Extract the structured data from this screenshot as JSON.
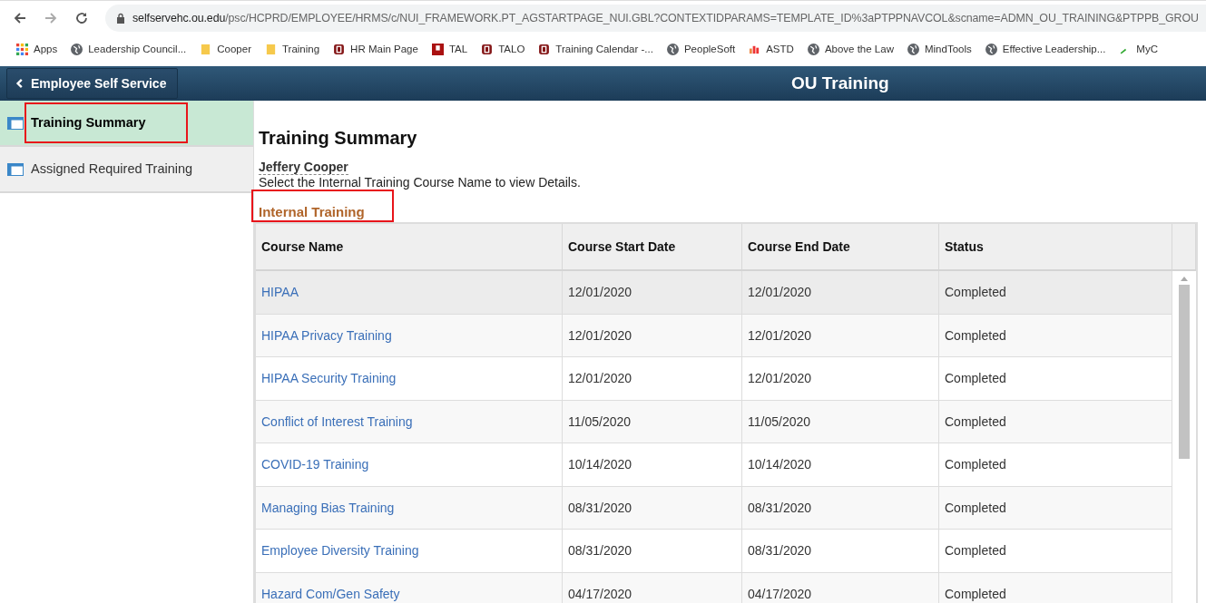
{
  "browser": {
    "url_host": "selfservehc.ou.edu",
    "url_path": "/psc/HCPRD/EMPLOYEE/HRMS/c/NUI_FRAMEWORK.PT_AGSTARTPAGE_NUI.GBL?CONTEXTIDPARAMS=TEMPLATE_ID%3aPTPPNAVCOL&scname=ADMN_OU_TRAINING&PTPPB_GROU",
    "bookmarks": [
      {
        "label": "Apps",
        "kind": "apps"
      },
      {
        "label": "Leadership Council...",
        "kind": "globe"
      },
      {
        "label": "Cooper",
        "kind": "folder"
      },
      {
        "label": "Training",
        "kind": "folder"
      },
      {
        "label": "HR Main Page",
        "kind": "ou"
      },
      {
        "label": "TAL",
        "kind": "hsc"
      },
      {
        "label": "TALO",
        "kind": "ou"
      },
      {
        "label": "Training Calendar -...",
        "kind": "ou"
      },
      {
        "label": "PeopleSoft",
        "kind": "globe"
      },
      {
        "label": "ASTD",
        "kind": "atd"
      },
      {
        "label": "Above the Law",
        "kind": "globe"
      },
      {
        "label": "MindTools",
        "kind": "globe"
      },
      {
        "label": "Effective Leadership...",
        "kind": "globe"
      },
      {
        "label": "MyC",
        "kind": "leaf"
      }
    ]
  },
  "header": {
    "back_label": "Employee Self Service",
    "title": "OU Training"
  },
  "sidebar": {
    "items": [
      {
        "label": "Training Summary",
        "selected": true,
        "highlighted": true
      },
      {
        "label": "Assigned Required Training",
        "selected": false,
        "highlighted": false
      }
    ]
  },
  "content": {
    "title": "Training Summary",
    "employee": "Jeffery Cooper",
    "instruction": "Select the Internal Training Course Name to view Details.",
    "section": {
      "title": "Internal Training",
      "highlighted": true
    },
    "table": {
      "columns": [
        "Course Name",
        "Course Start Date",
        "Course End Date",
        "Status"
      ],
      "rows": [
        {
          "course": "HIPAA",
          "start": "12/01/2020",
          "end": "12/01/2020",
          "status": "Completed",
          "selected": true
        },
        {
          "course": "HIPAA Privacy Training",
          "start": "12/01/2020",
          "end": "12/01/2020",
          "status": "Completed",
          "selected": false
        },
        {
          "course": "HIPAA Security Training",
          "start": "12/01/2020",
          "end": "12/01/2020",
          "status": "Completed",
          "selected": false
        },
        {
          "course": "Conflict of Interest Training",
          "start": "11/05/2020",
          "end": "11/05/2020",
          "status": "Completed",
          "selected": false
        },
        {
          "course": "COVID-19 Training",
          "start": "10/14/2020",
          "end": "10/14/2020",
          "status": "Completed",
          "selected": false
        },
        {
          "course": "Managing Bias Training",
          "start": "08/31/2020",
          "end": "08/31/2020",
          "status": "Completed",
          "selected": false
        },
        {
          "course": "Employee Diversity Training",
          "start": "08/31/2020",
          "end": "08/31/2020",
          "status": "Completed",
          "selected": false
        },
        {
          "course": "Hazard Com/Gen Safety",
          "start": "04/17/2020",
          "end": "04/17/2020",
          "status": "Completed",
          "selected": false
        }
      ]
    }
  }
}
